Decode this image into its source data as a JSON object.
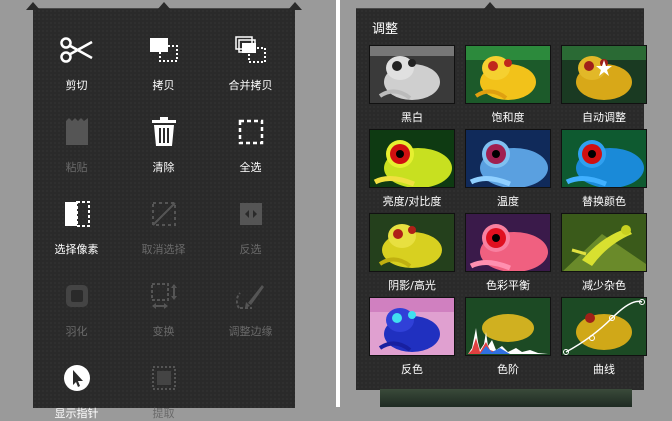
{
  "edit_menu": {
    "items": [
      {
        "id": "cut",
        "label": "剪切",
        "icon": "scissors-icon",
        "enabled": true
      },
      {
        "id": "copy",
        "label": "拷贝",
        "icon": "copy-icon",
        "enabled": true
      },
      {
        "id": "copy-merged",
        "label": "合并拷贝",
        "icon": "copy-merged-icon",
        "enabled": true
      },
      {
        "id": "paste",
        "label": "粘贴",
        "icon": "paste-icon",
        "enabled": false
      },
      {
        "id": "clear",
        "label": "清除",
        "icon": "trash-icon",
        "enabled": true
      },
      {
        "id": "select-all",
        "label": "全选",
        "icon": "select-all-icon",
        "enabled": true
      },
      {
        "id": "select-pixels",
        "label": "选择像素",
        "icon": "select-pixels-icon",
        "enabled": true
      },
      {
        "id": "deselect",
        "label": "取消选择",
        "icon": "deselect-icon",
        "enabled": false
      },
      {
        "id": "invert",
        "label": "反选",
        "icon": "invert-selection-icon",
        "enabled": false
      },
      {
        "id": "feather",
        "label": "羽化",
        "icon": "feather-icon",
        "enabled": false
      },
      {
        "id": "transform",
        "label": "变换",
        "icon": "transform-icon",
        "enabled": false
      },
      {
        "id": "refine-edge",
        "label": "调整边缘",
        "icon": "refine-edge-brush-icon",
        "enabled": false
      },
      {
        "id": "show-pointer",
        "label": "显示指针",
        "icon": "pointer-icon",
        "enabled": true
      },
      {
        "id": "extract",
        "label": "提取",
        "icon": "extract-icon",
        "enabled": false
      }
    ]
  },
  "adjustments": {
    "title": "调整",
    "items": [
      {
        "label": "黑白",
        "thumb": "black-white"
      },
      {
        "label": "饱和度",
        "thumb": "saturation"
      },
      {
        "label": "自动调整",
        "thumb": "auto-adjust"
      },
      {
        "label": "亮度/对比度",
        "thumb": "brightness-contrast"
      },
      {
        "label": "温度",
        "thumb": "temperature"
      },
      {
        "label": "替换颜色",
        "thumb": "replace-color"
      },
      {
        "label": "阴影/高光",
        "thumb": "shadows-highlights"
      },
      {
        "label": "色彩平衡",
        "thumb": "color-balance"
      },
      {
        "label": "减少杂色",
        "thumb": "reduce-noise"
      },
      {
        "label": "反色",
        "thumb": "invert"
      },
      {
        "label": "色阶",
        "thumb": "levels"
      },
      {
        "label": "曲线",
        "thumb": "curves"
      }
    ]
  },
  "colors": {
    "panel_bg": "#2a2a2a",
    "enabled_text": "#ffffff",
    "disabled_text": "#6a6a6a"
  }
}
